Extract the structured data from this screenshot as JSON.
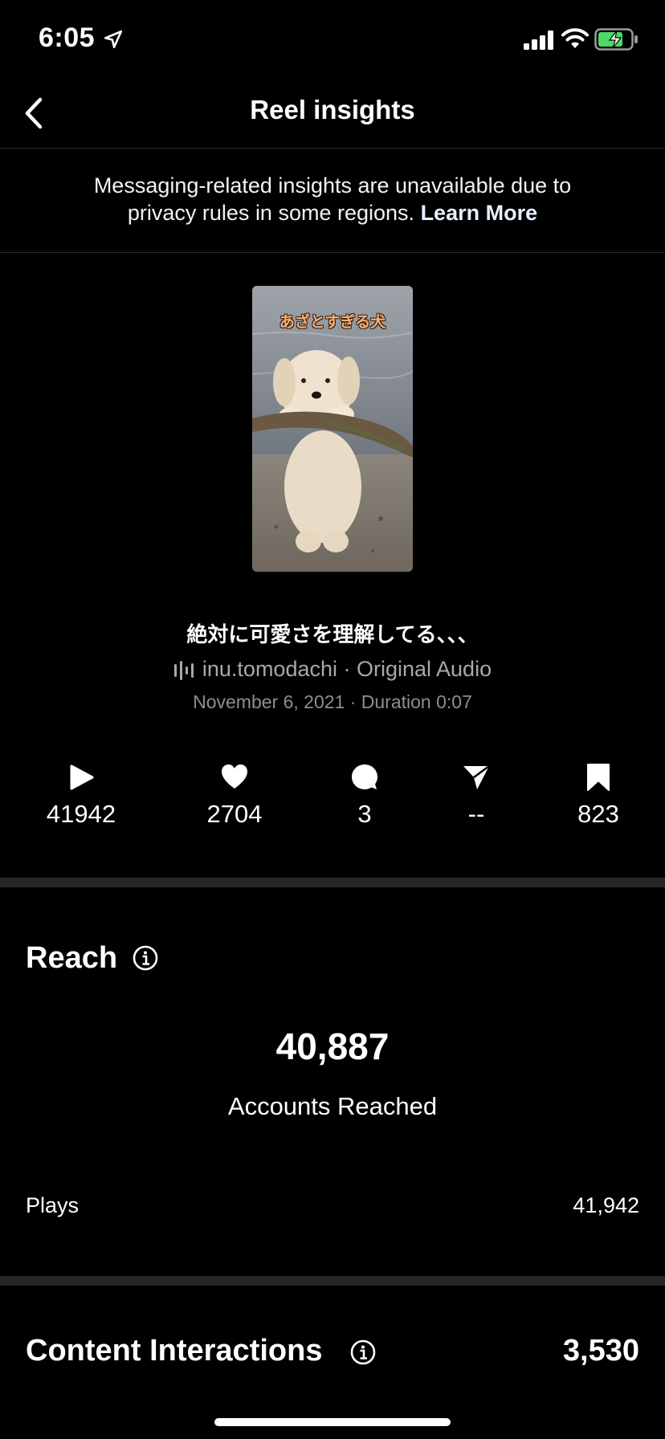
{
  "status_bar": {
    "time": "6:05"
  },
  "nav": {
    "title": "Reel insights"
  },
  "notice": {
    "line1": "Messaging-related insights are unavailable due to",
    "line2": "privacy rules in some regions.",
    "link": "Learn More"
  },
  "thumbnail": {
    "caption": "あざとすぎる犬"
  },
  "reel": {
    "caption": "絶対に可愛さを理解してる、、、",
    "audio": "inu.tomodachi · Original Audio",
    "date_duration": "November 6, 2021 · Duration 0:07"
  },
  "stats": {
    "plays": "41942",
    "likes": "2704",
    "comments": "3",
    "shares": "--",
    "saves": "823"
  },
  "reach": {
    "title": "Reach",
    "accounts_reached_value": "40,887",
    "accounts_reached_label": "Accounts Reached",
    "plays_label": "Plays",
    "plays_value": "41,942"
  },
  "content_interactions": {
    "title": "Content Interactions",
    "value": "3,530"
  },
  "colors": {
    "background": "#000000",
    "divider": "#262626",
    "muted": "#a8a8a8",
    "battery": "#4cd964"
  }
}
